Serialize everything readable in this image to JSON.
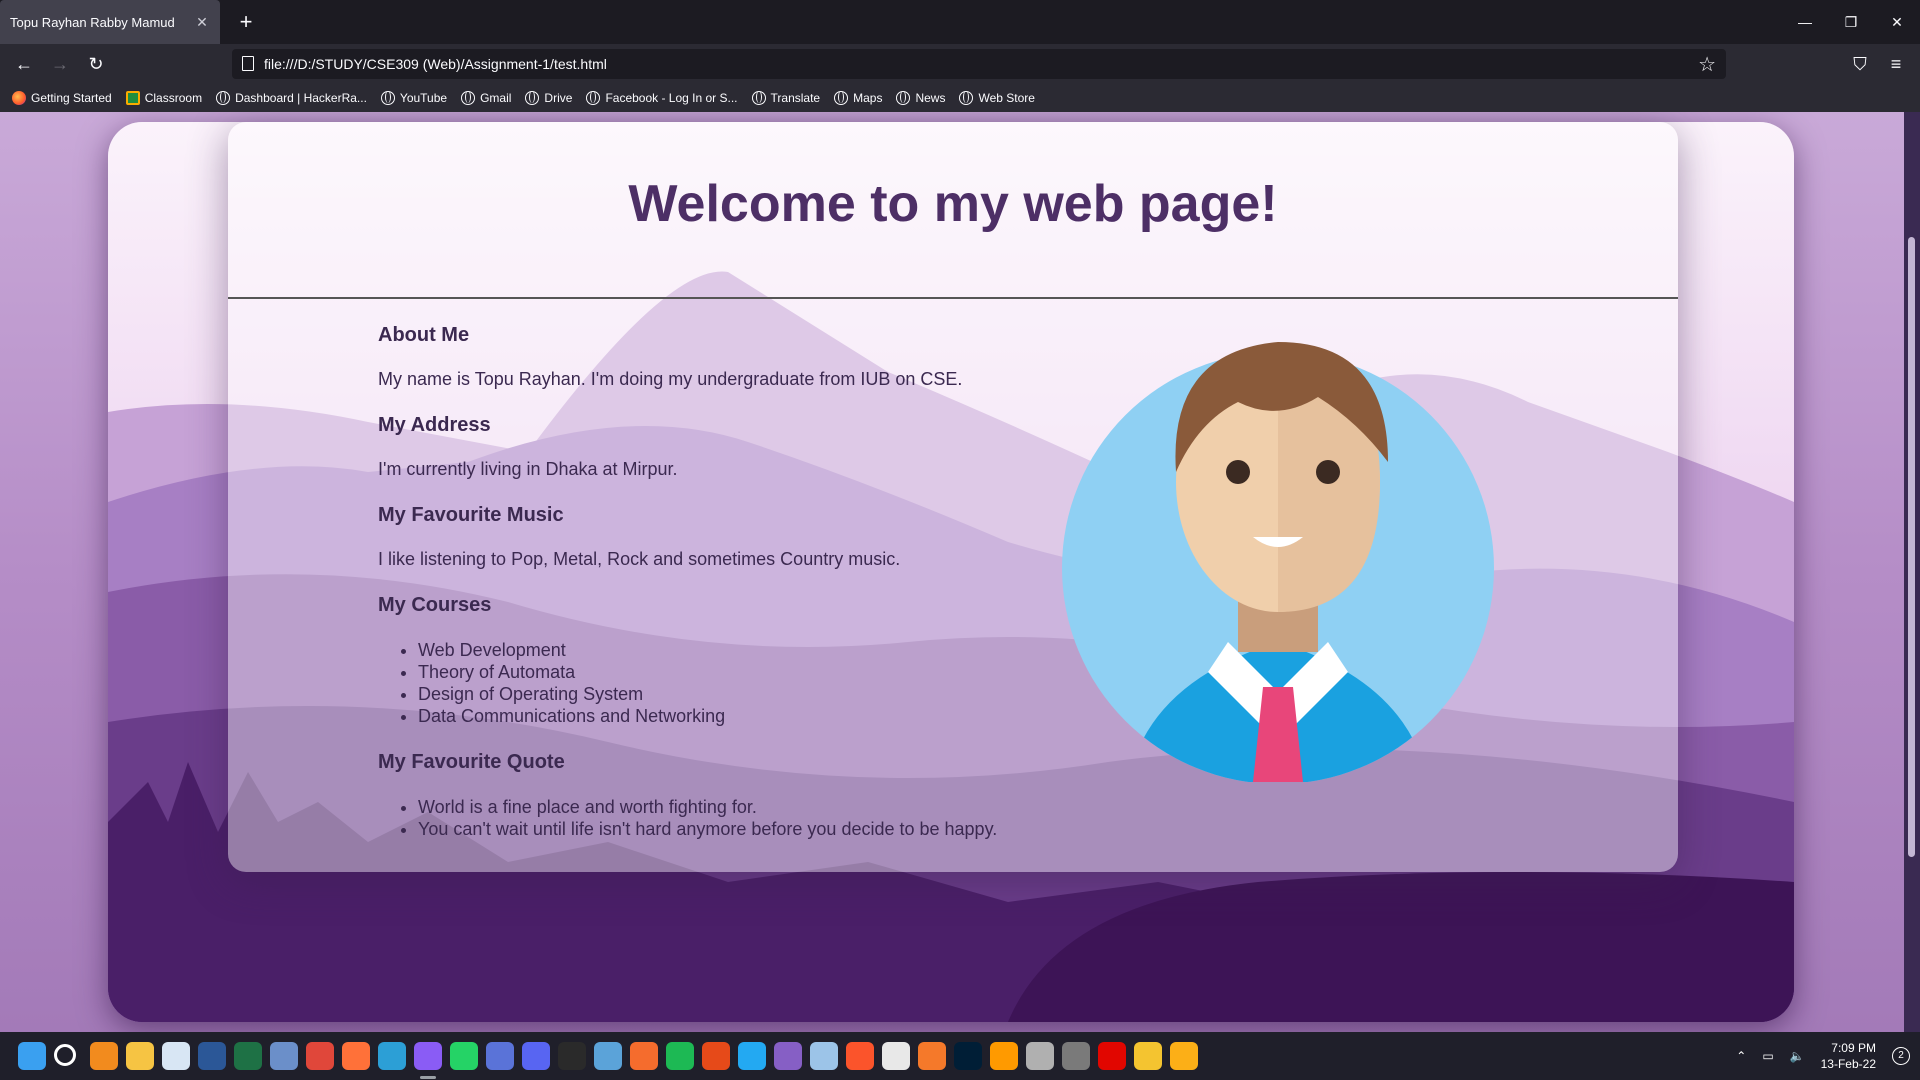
{
  "browser": {
    "tab_title": "Topu Rayhan Rabby Mamud",
    "tab_close": "✕",
    "new_tab": "+",
    "url": "file:///D:/STUDY/CSE309 (Web)/Assignment-1/test.html",
    "window_controls": {
      "minimize": "—",
      "restore": "❐",
      "close": "✕"
    },
    "nav": {
      "back": "←",
      "forward": "→",
      "reload": "↻",
      "star": "☆",
      "pocket": "⛉",
      "menu": "≡"
    },
    "bookmarks": [
      {
        "label": "Getting Started",
        "icon": "firefox-icon"
      },
      {
        "label": "Classroom",
        "icon": "classroom-icon"
      },
      {
        "label": "Dashboard | HackerRa...",
        "icon": "globe-icon"
      },
      {
        "label": "YouTube",
        "icon": "globe-icon"
      },
      {
        "label": "Gmail",
        "icon": "globe-icon"
      },
      {
        "label": "Drive",
        "icon": "globe-icon"
      },
      {
        "label": "Facebook - Log In or S...",
        "icon": "globe-icon"
      },
      {
        "label": "Translate",
        "icon": "globe-icon"
      },
      {
        "label": "Maps",
        "icon": "globe-icon"
      },
      {
        "label": "News",
        "icon": "globe-icon"
      },
      {
        "label": "Web Store",
        "icon": "globe-icon"
      }
    ]
  },
  "page": {
    "title": "Welcome to my web page!",
    "sections": {
      "about_heading": "About Me",
      "about_text": "My name is Topu Rayhan. I'm doing my undergraduate from IUB on CSE.",
      "address_heading": "My Address",
      "address_text": "I'm currently living in Dhaka at Mirpur.",
      "music_heading": "My Favourite Music",
      "music_text": "I like listening to Pop, Metal, Rock and sometimes Country music.",
      "courses_heading": "My Courses",
      "courses": [
        "Web Development",
        "Theory of Automata",
        "Design of Operating System",
        "Data Communications and Networking"
      ],
      "quote_heading": "My Favourite Quote",
      "quotes": [
        "World is a fine place and worth fighting for.",
        "You can't wait until life isn't hard anymore before you decide to be happy."
      ]
    }
  },
  "taskbar": {
    "time": "7:09 PM",
    "date": "13-Feb-22",
    "notifications": "2",
    "apps": [
      {
        "name": "windows-start-icon",
        "color": "#3aa0f0"
      },
      {
        "name": "search-icon",
        "color": "#ffffff"
      },
      {
        "name": "everything-search-icon",
        "color": "#f28b1e"
      },
      {
        "name": "file-explorer-icon",
        "color": "#f6c443"
      },
      {
        "name": "notepad-icon",
        "color": "#d8e6f4"
      },
      {
        "name": "word-icon",
        "color": "#2b5797"
      },
      {
        "name": "excel-icon",
        "color": "#1e7145"
      },
      {
        "name": "task-manager-icon",
        "color": "#6b8fc9"
      },
      {
        "name": "chrome-icon",
        "color": "#e0473a"
      },
      {
        "name": "firefox-icon",
        "color": "#ff7139"
      },
      {
        "name": "edge-icon",
        "color": "#2c9fd6"
      },
      {
        "name": "messenger-icon",
        "color": "#8a5cf5"
      },
      {
        "name": "whatsapp-icon",
        "color": "#25d366"
      },
      {
        "name": "w-app-icon",
        "color": "#5a73d8"
      },
      {
        "name": "discord-icon",
        "color": "#5865f2"
      },
      {
        "name": "epic-games-icon",
        "color": "#2a2a2a"
      },
      {
        "name": "steam-icon",
        "color": "#5ba3d9"
      },
      {
        "name": "origin-icon",
        "color": "#f56c2d"
      },
      {
        "name": "spotify-icon",
        "color": "#1db954"
      },
      {
        "name": "office-icon",
        "color": "#e64a19"
      },
      {
        "name": "vscode-icon",
        "color": "#23a9f2"
      },
      {
        "name": "visual-studio-icon",
        "color": "#865fc5"
      },
      {
        "name": "virtualbox-icon",
        "color": "#9cc4e8"
      },
      {
        "name": "brave-icon",
        "color": "#fb542b"
      },
      {
        "name": "unity-icon",
        "color": "#e8e8e8"
      },
      {
        "name": "blender-icon",
        "color": "#f5792a"
      },
      {
        "name": "photoshop-icon",
        "color": "#001e36"
      },
      {
        "name": "illustrator-icon",
        "color": "#ff9a00"
      },
      {
        "name": "rk-app-icon",
        "color": "#b0b0b0"
      },
      {
        "name": "obs-icon",
        "color": "#7a7a7a"
      },
      {
        "name": "f1-game-icon",
        "color": "#e10600"
      },
      {
        "name": "valorant-icon",
        "color": "#f4c430"
      },
      {
        "name": "rockstar-icon",
        "color": "#fcaf17"
      }
    ]
  },
  "colors": {
    "title": "#4d2f66",
    "text": "#3b2950",
    "sky": "#f3dff5",
    "mountain": "#a77fc4",
    "forest": "#3d1456"
  }
}
